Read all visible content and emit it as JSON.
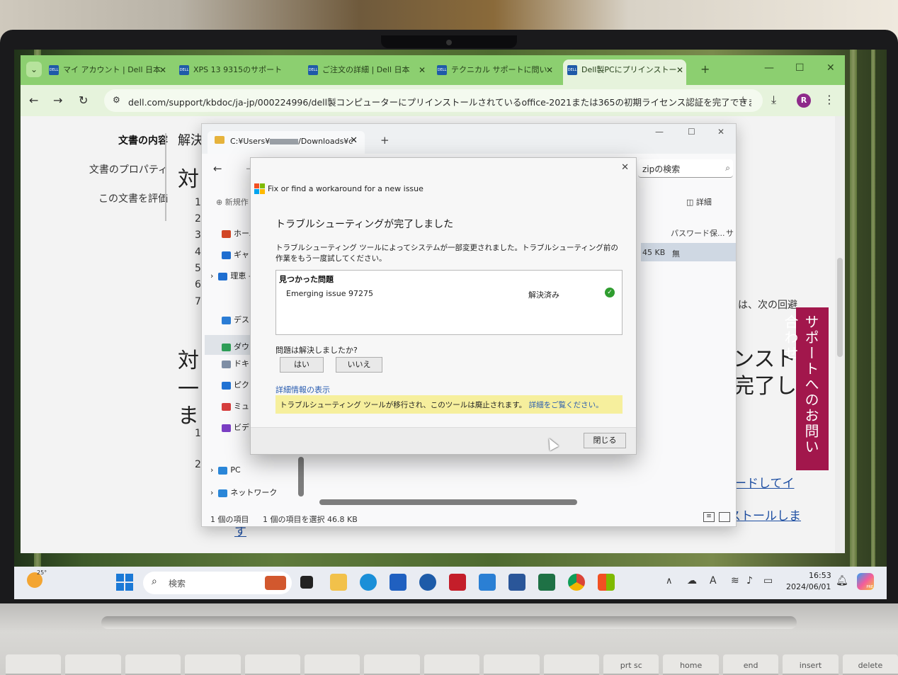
{
  "browser": {
    "tabs": [
      {
        "label": "マイ アカウント | Dell 日本"
      },
      {
        "label": "XPS 13 9315のサポート"
      },
      {
        "label": "ご注文の詳細 | Dell 日本"
      },
      {
        "label": "テクニカル サポートに問い"
      },
      {
        "label": "Dell製PCにプリインストー"
      }
    ],
    "favicon_text": "DELL",
    "url": "dell.com/support/kbdoc/ja-jp/000224996/dell製コンピューターにプリインストールされているoffice-2021または365の初期ライセンス認証を完了できません",
    "profile_initial": "R",
    "accent_color": "#8ccf70"
  },
  "page": {
    "toc": [
      "文書の内容",
      "文書のプロパティ",
      "この文書を評価"
    ],
    "heading_fragments": [
      "解決",
      "対",
      "対",
      "一",
      "ま"
    ],
    "numbers": [
      "1",
      "2",
      "3",
      "4",
      "5",
      "6",
      "7",
      "1",
      "2"
    ],
    "right_heading_line1": "ンスト",
    "right_heading_line2": "完了し",
    "body_fragment": "は、次の回避",
    "link_fragment_1": "ードしてイ",
    "link_fragment_2": "ストールしま",
    "link_fragment_3": "す",
    "support_tab_label": "サポートへのお問い合わせ"
  },
  "explorer": {
    "path_prefix": "C:¥Users¥",
    "path_suffix": "/Downloads¥c",
    "search_placeholder": "zipの検索",
    "new_label": "新規作",
    "details_label": "詳細",
    "sidebar": [
      {
        "label": "ホーム"
      },
      {
        "label": "ギャラリ"
      },
      {
        "label": "理恵 -"
      },
      {
        "label": "デスクト"
      },
      {
        "label": "ダウンロ"
      },
      {
        "label": "ドキュメ"
      },
      {
        "label": "ピクチャ"
      },
      {
        "label": "ミュージ"
      },
      {
        "label": "ビデオ"
      },
      {
        "label": "PC"
      },
      {
        "label": "ネットワーク"
      }
    ],
    "columns": [
      "パスワード保...",
      "サ"
    ],
    "row": {
      "size": "45 KB",
      "protected": "無"
    },
    "status_items": "1 個の項目",
    "status_selected": "1 個の項目を選択  46.8 KB"
  },
  "dialog": {
    "title": "Fix or find a workaround for a new issue",
    "heading": "トラブルシューティングが完了しました",
    "description": "トラブルシューティング ツールによってシステムが一部変更されました。トラブルシューティング前の作業をもう一度試してください。",
    "problems_heading": "見つかった問題",
    "issue_name": "Emerging issue 97275",
    "issue_status": "解決済み",
    "solved_question": "問題は解決しましたか?",
    "yes_label": "はい",
    "no_label": "いいえ",
    "details_link": "詳細情報の表示",
    "notice_text": "トラブルシューティング ツールが移行され、このツールは廃止されます。",
    "notice_link": "詳細をご覧ください。",
    "close_label": "閉じる"
  },
  "taskbar": {
    "temperature": "25°",
    "search_placeholder": "検索",
    "time": "16:53",
    "date": "2024/06/01",
    "ime_indicator": "A",
    "copilot_badge": "PRE"
  },
  "keyboard": [
    "",
    "",
    "",
    "",
    "",
    "",
    "",
    "",
    "",
    "",
    "prt sc",
    "home",
    "end",
    "insert",
    "delete"
  ]
}
